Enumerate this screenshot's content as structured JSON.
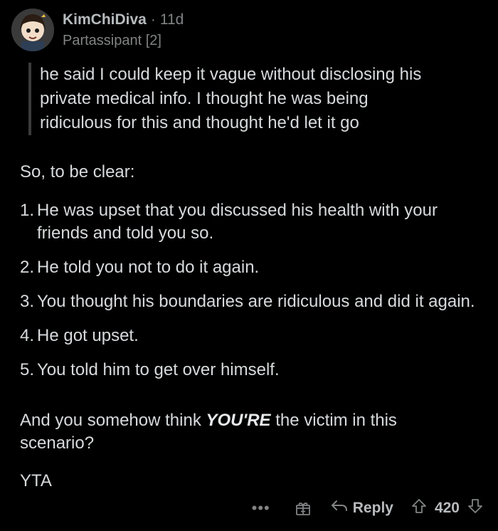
{
  "comment": {
    "username": "KimChiDiva",
    "separator": "·",
    "age": "11d",
    "flair": "Partassipant [2]",
    "quote": "he said I could keep it vague without disclosing his\nprivate medical info. I thought he was being\nridiculous for this and thought he'd let it go",
    "intro": "So, to be clear:",
    "list": [
      {
        "num": "1.",
        "text": "He was upset that you discussed his health with your friends and told you so."
      },
      {
        "num": "2.",
        "text": "He told you not to do it again."
      },
      {
        "num": "3.",
        "text": "You thought his boundaries are ridiculous and did it again."
      },
      {
        "num": "4.",
        "text": "He got upset."
      },
      {
        "num": "5.",
        "text": "You told him to get over himself."
      }
    ],
    "conclusion_pre": "And you somehow think ",
    "conclusion_em": "YOU'RE",
    "conclusion_post": " the victim in this scenario?",
    "verdict": "YTA"
  },
  "actions": {
    "more_icon": "ellipsis-icon",
    "more_label": "•••",
    "gift_icon": "gift-icon",
    "reply_icon": "reply-arrow-icon",
    "reply_label": "Reply",
    "upvote_icon": "upvote-arrow-icon",
    "vote_count": "420",
    "downvote_icon": "downvote-arrow-icon"
  }
}
